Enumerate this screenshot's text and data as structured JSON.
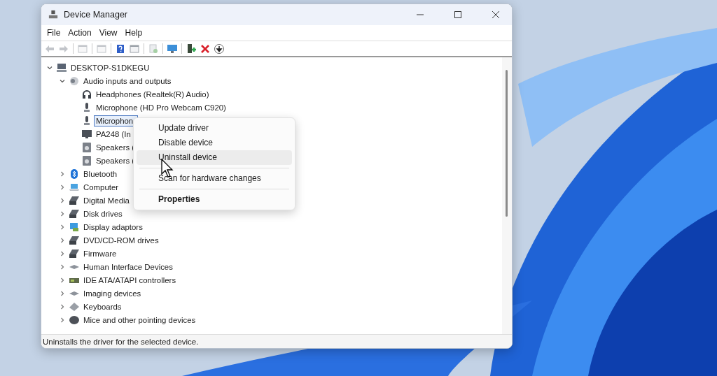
{
  "window": {
    "title": "Device Manager"
  },
  "menu_bar": [
    "File",
    "Action",
    "View",
    "Help"
  ],
  "toolbar": [
    {
      "kind": "back",
      "disabled": true
    },
    {
      "kind": "forward",
      "disabled": true
    },
    {
      "kind": "sep"
    },
    {
      "kind": "sheet",
      "disabled": true
    },
    {
      "kind": "sep"
    },
    {
      "kind": "sheet",
      "disabled": true
    },
    {
      "kind": "sep"
    },
    {
      "kind": "help",
      "disabled": false
    },
    {
      "kind": "sheet",
      "disabled": false
    },
    {
      "kind": "sep"
    },
    {
      "kind": "scan",
      "disabled": true
    },
    {
      "kind": "sep"
    },
    {
      "kind": "monitor",
      "disabled": false
    },
    {
      "kind": "sep"
    },
    {
      "kind": "driver",
      "disabled": false
    },
    {
      "kind": "remove",
      "disabled": false
    },
    {
      "kind": "download",
      "disabled": false
    }
  ],
  "tree": [
    {
      "label": "DESKTOP-S1DKEGU",
      "kind": "computer",
      "expanded": true,
      "selected": false,
      "children": [
        {
          "label": "Audio inputs and outputs",
          "kind": "audio",
          "expanded": true,
          "selected": false,
          "children": [
            {
              "label": "Headphones (Realtek(R) Audio)",
              "kind": "headphones",
              "selected": false
            },
            {
              "label": "Microphone (HD Pro Webcam C920)",
              "kind": "microphone",
              "selected": false
            },
            {
              "label": "Microphon",
              "kind": "microphone",
              "selected": true
            },
            {
              "label": "PA248 (In",
              "kind": "monitor",
              "selected": false
            },
            {
              "label": "Speakers (",
              "kind": "speaker",
              "selected": false
            },
            {
              "label": "Speakers (",
              "kind": "speaker",
              "selected": false
            }
          ]
        },
        {
          "label": "Bluetooth",
          "kind": "bluetooth",
          "expanded": false,
          "selected": false
        },
        {
          "label": "Computer",
          "kind": "laptop",
          "expanded": false,
          "selected": false
        },
        {
          "label": "Digital Media",
          "kind": "drive",
          "expanded": false,
          "selected": false
        },
        {
          "label": "Disk drives",
          "kind": "drive",
          "expanded": false,
          "selected": false
        },
        {
          "label": "Display adaptors",
          "kind": "display",
          "expanded": false,
          "selected": false
        },
        {
          "label": "DVD/CD-ROM drives",
          "kind": "drive",
          "expanded": false,
          "selected": false
        },
        {
          "label": "Firmware",
          "kind": "drive",
          "expanded": false,
          "selected": false
        },
        {
          "label": "Human Interface Devices",
          "kind": "hid",
          "expanded": false,
          "selected": false
        },
        {
          "label": "IDE ATA/ATAPI controllers",
          "kind": "controller",
          "expanded": false,
          "selected": false
        },
        {
          "label": "Imaging devices",
          "kind": "hid",
          "expanded": false,
          "selected": false
        },
        {
          "label": "Keyboards",
          "kind": "keyboard",
          "expanded": false,
          "selected": false
        },
        {
          "label": "Mice and other pointing devices",
          "kind": "mouse",
          "expanded": false,
          "selected": false
        }
      ]
    }
  ],
  "context_menu": [
    {
      "label": "Update driver",
      "kind": "item",
      "bold": false,
      "hovered": false
    },
    {
      "label": "Disable device",
      "kind": "item",
      "bold": false,
      "hovered": false
    },
    {
      "label": "Uninstall device",
      "kind": "item",
      "bold": false,
      "hovered": true
    },
    {
      "kind": "separator"
    },
    {
      "label": "Scan for hardware changes",
      "kind": "item",
      "bold": false,
      "hovered": false
    },
    {
      "kind": "separator"
    },
    {
      "label": "Properties",
      "kind": "item",
      "bold": true,
      "hovered": false
    }
  ],
  "status_bar": "Uninstalls the driver for the selected device."
}
